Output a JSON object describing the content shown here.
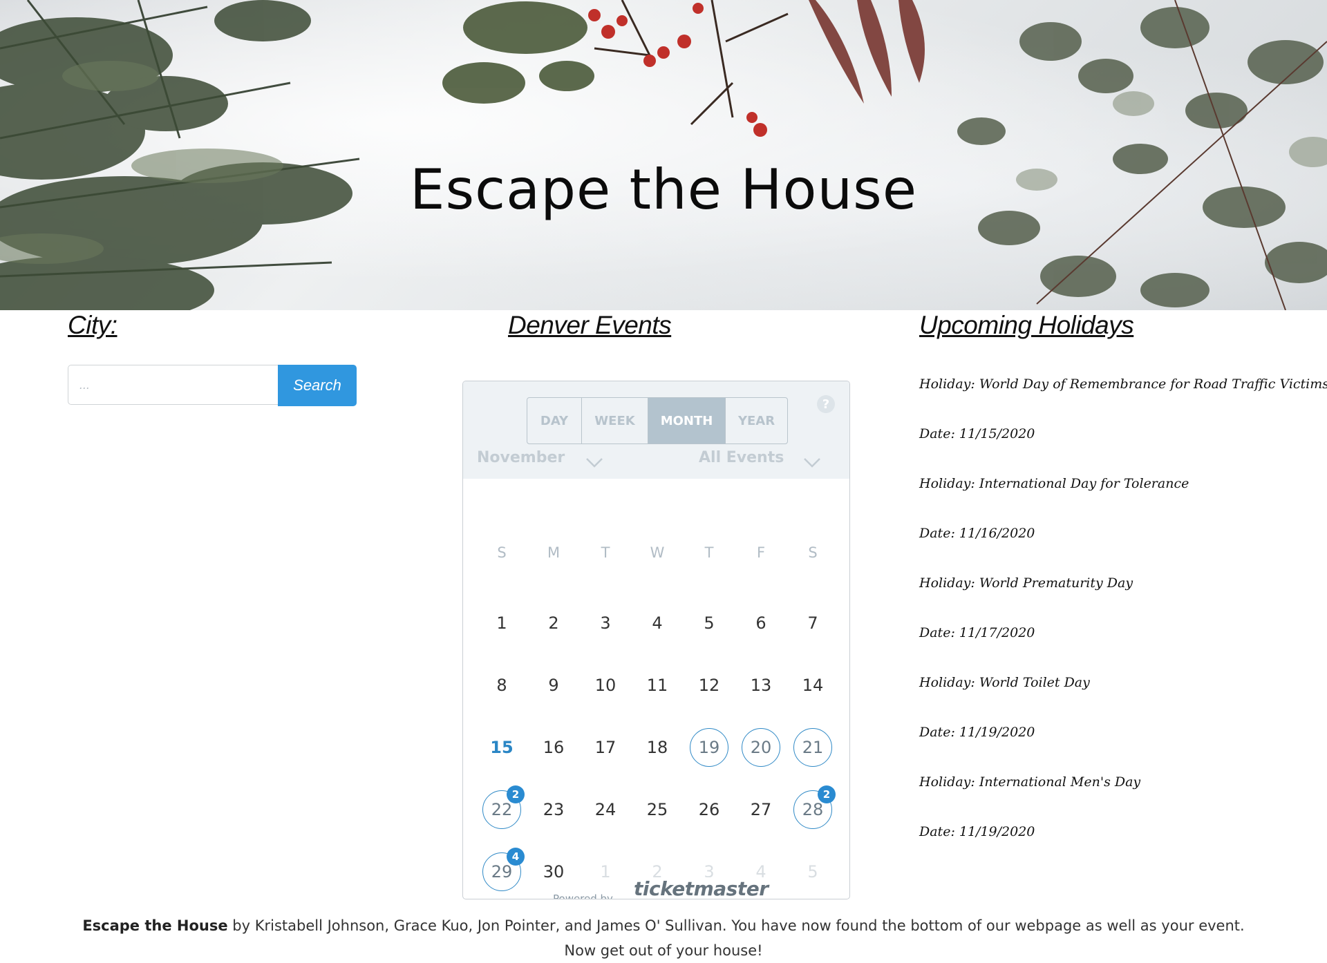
{
  "hero": {
    "title": "Escape the House"
  },
  "city": {
    "heading": "City:",
    "search_placeholder": "...",
    "search_button": "Search"
  },
  "events": {
    "heading": "Denver Events",
    "views": [
      "DAY",
      "WEEK",
      "MONTH",
      "YEAR"
    ],
    "active_view": "MONTH",
    "help_label": "?",
    "month": "November",
    "filter": "All Events",
    "weekdays": [
      "S",
      "M",
      "T",
      "W",
      "T",
      "F",
      "S"
    ],
    "weeks": [
      [
        {
          "d": "1"
        },
        {
          "d": "2"
        },
        {
          "d": "3"
        },
        {
          "d": "4"
        },
        {
          "d": "5"
        },
        {
          "d": "6"
        },
        {
          "d": "7"
        }
      ],
      [
        {
          "d": "8"
        },
        {
          "d": "9"
        },
        {
          "d": "10"
        },
        {
          "d": "11"
        },
        {
          "d": "12"
        },
        {
          "d": "13"
        },
        {
          "d": "14"
        }
      ],
      [
        {
          "d": "15",
          "today": true
        },
        {
          "d": "16"
        },
        {
          "d": "17"
        },
        {
          "d": "18"
        },
        {
          "d": "19",
          "event": true
        },
        {
          "d": "20",
          "event": true
        },
        {
          "d": "21",
          "event": true
        }
      ],
      [
        {
          "d": "22",
          "event": true,
          "count": "2"
        },
        {
          "d": "23"
        },
        {
          "d": "24"
        },
        {
          "d": "25"
        },
        {
          "d": "26"
        },
        {
          "d": "27"
        },
        {
          "d": "28",
          "event": true,
          "count": "2"
        }
      ],
      [
        {
          "d": "29",
          "event": true,
          "count": "4"
        },
        {
          "d": "30"
        },
        {
          "d": "1",
          "other": true
        },
        {
          "d": "2",
          "other": true
        },
        {
          "d": "3",
          "other": true
        },
        {
          "d": "4",
          "other": true
        },
        {
          "d": "5",
          "other": true
        }
      ]
    ],
    "powered_by": "Powered by",
    "provider": "ticketmaster",
    "accent_color": "#2a8bd1"
  },
  "holidays": {
    "heading": "Upcoming Holidays",
    "items": [
      {
        "holiday": "Holiday: World Day of Remembrance for Road Traffic Victims",
        "date": "Date: 11/15/2020"
      },
      {
        "holiday": "Holiday: International Day for Tolerance",
        "date": "Date: 11/16/2020"
      },
      {
        "holiday": "Holiday: World Prematurity Day",
        "date": "Date: 11/17/2020"
      },
      {
        "holiday": "Holiday: World Toilet Day",
        "date": "Date: 11/19/2020"
      },
      {
        "holiday": "Holiday: International Men's Day",
        "date": "Date: 11/19/2020"
      }
    ]
  },
  "footer": {
    "brand": "Escape the House",
    "line1": " by Kristabell Johnson, Grace Kuo, Jon Pointer, and James O' Sullivan. You have now found the bottom of our webpage as well as your event.",
    "line2": "Now get out of your house!"
  }
}
